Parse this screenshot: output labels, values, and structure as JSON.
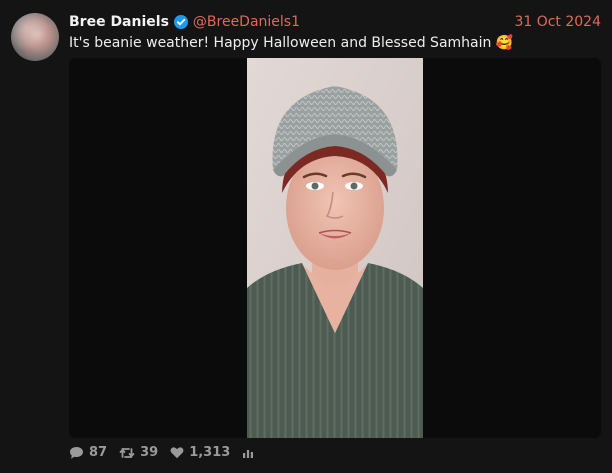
{
  "tweet": {
    "author_name": "Bree Daniels",
    "handle": "@BreeDaniels1",
    "date": "31 Oct 2024",
    "text": "It's beanie weather! Happy Halloween and Blessed Samhain 🥰",
    "media": {
      "type": "photo"
    },
    "stats": {
      "replies": "87",
      "retweets": "39",
      "likes": "1,313"
    }
  },
  "colors": {
    "background": "#141414",
    "accent": "#e06a58",
    "verified": "#1d9bf0",
    "muted": "#9a9a9a"
  },
  "icons": {
    "verified": "verified-badge-icon",
    "reply": "comment-icon",
    "retweet": "retweet-icon",
    "like": "heart-icon",
    "views": "bar-chart-icon"
  }
}
